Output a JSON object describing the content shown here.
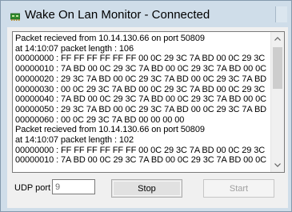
{
  "window": {
    "title": "Wake On Lan Monitor - Connected"
  },
  "log": {
    "lines": [
      "Packet recieved from 10.14.130.66 on port 50809",
      "at 14:10:07 packet length : 106",
      "00000000 : FF FF FF FF FF FF 00 0C 29 3C 7A BD 00 0C 29 3C",
      "00000010 : 7A BD 00 0C 29 3C 7A BD 00 0C 29 3C 7A BD 00 0C",
      "00000020 : 29 3C 7A BD 00 0C 29 3C 7A BD 00 0C 29 3C 7A BD",
      "00000030 : 00 0C 29 3C 7A BD 00 0C 29 3C 7A BD 00 0C 29 3C",
      "00000040 : 7A BD 00 0C 29 3C 7A BD 00 0C 29 3C 7A BD 00 0C",
      "00000050 : 29 3C 7A BD 00 0C 29 3C 7A BD 00 0C 29 3C 7A BD",
      "00000060 : 00 0C 29 3C 7A BD 00 00 00 00",
      "Packet recieved from 10.14.130.66 on port 50809",
      "at 14:10:07 packet length : 102",
      "00000000 : FF FF FF FF FF FF 00 0C 29 3C 7A BD 00 0C 29 3C",
      "00000010 : 7A BD 00 0C 29 3C 7A BD 00 0C 29 3C 7A BD 00 0C"
    ]
  },
  "controls": {
    "udp_port_label": "UDP port",
    "udp_port_value": "9",
    "stop_label": "Stop",
    "start_label": "Start"
  },
  "icons": {
    "app": "network-card-icon",
    "close": "close-icon",
    "scroll_up": "scroll-up-arrow-icon",
    "scroll_down": "scroll-down-arrow-icon"
  },
  "colors": {
    "title_bar": "#cfdde9",
    "client_bg": "#f0f0f0",
    "log_bg": "#ffffff",
    "disabled_text": "#a0a0a0"
  }
}
